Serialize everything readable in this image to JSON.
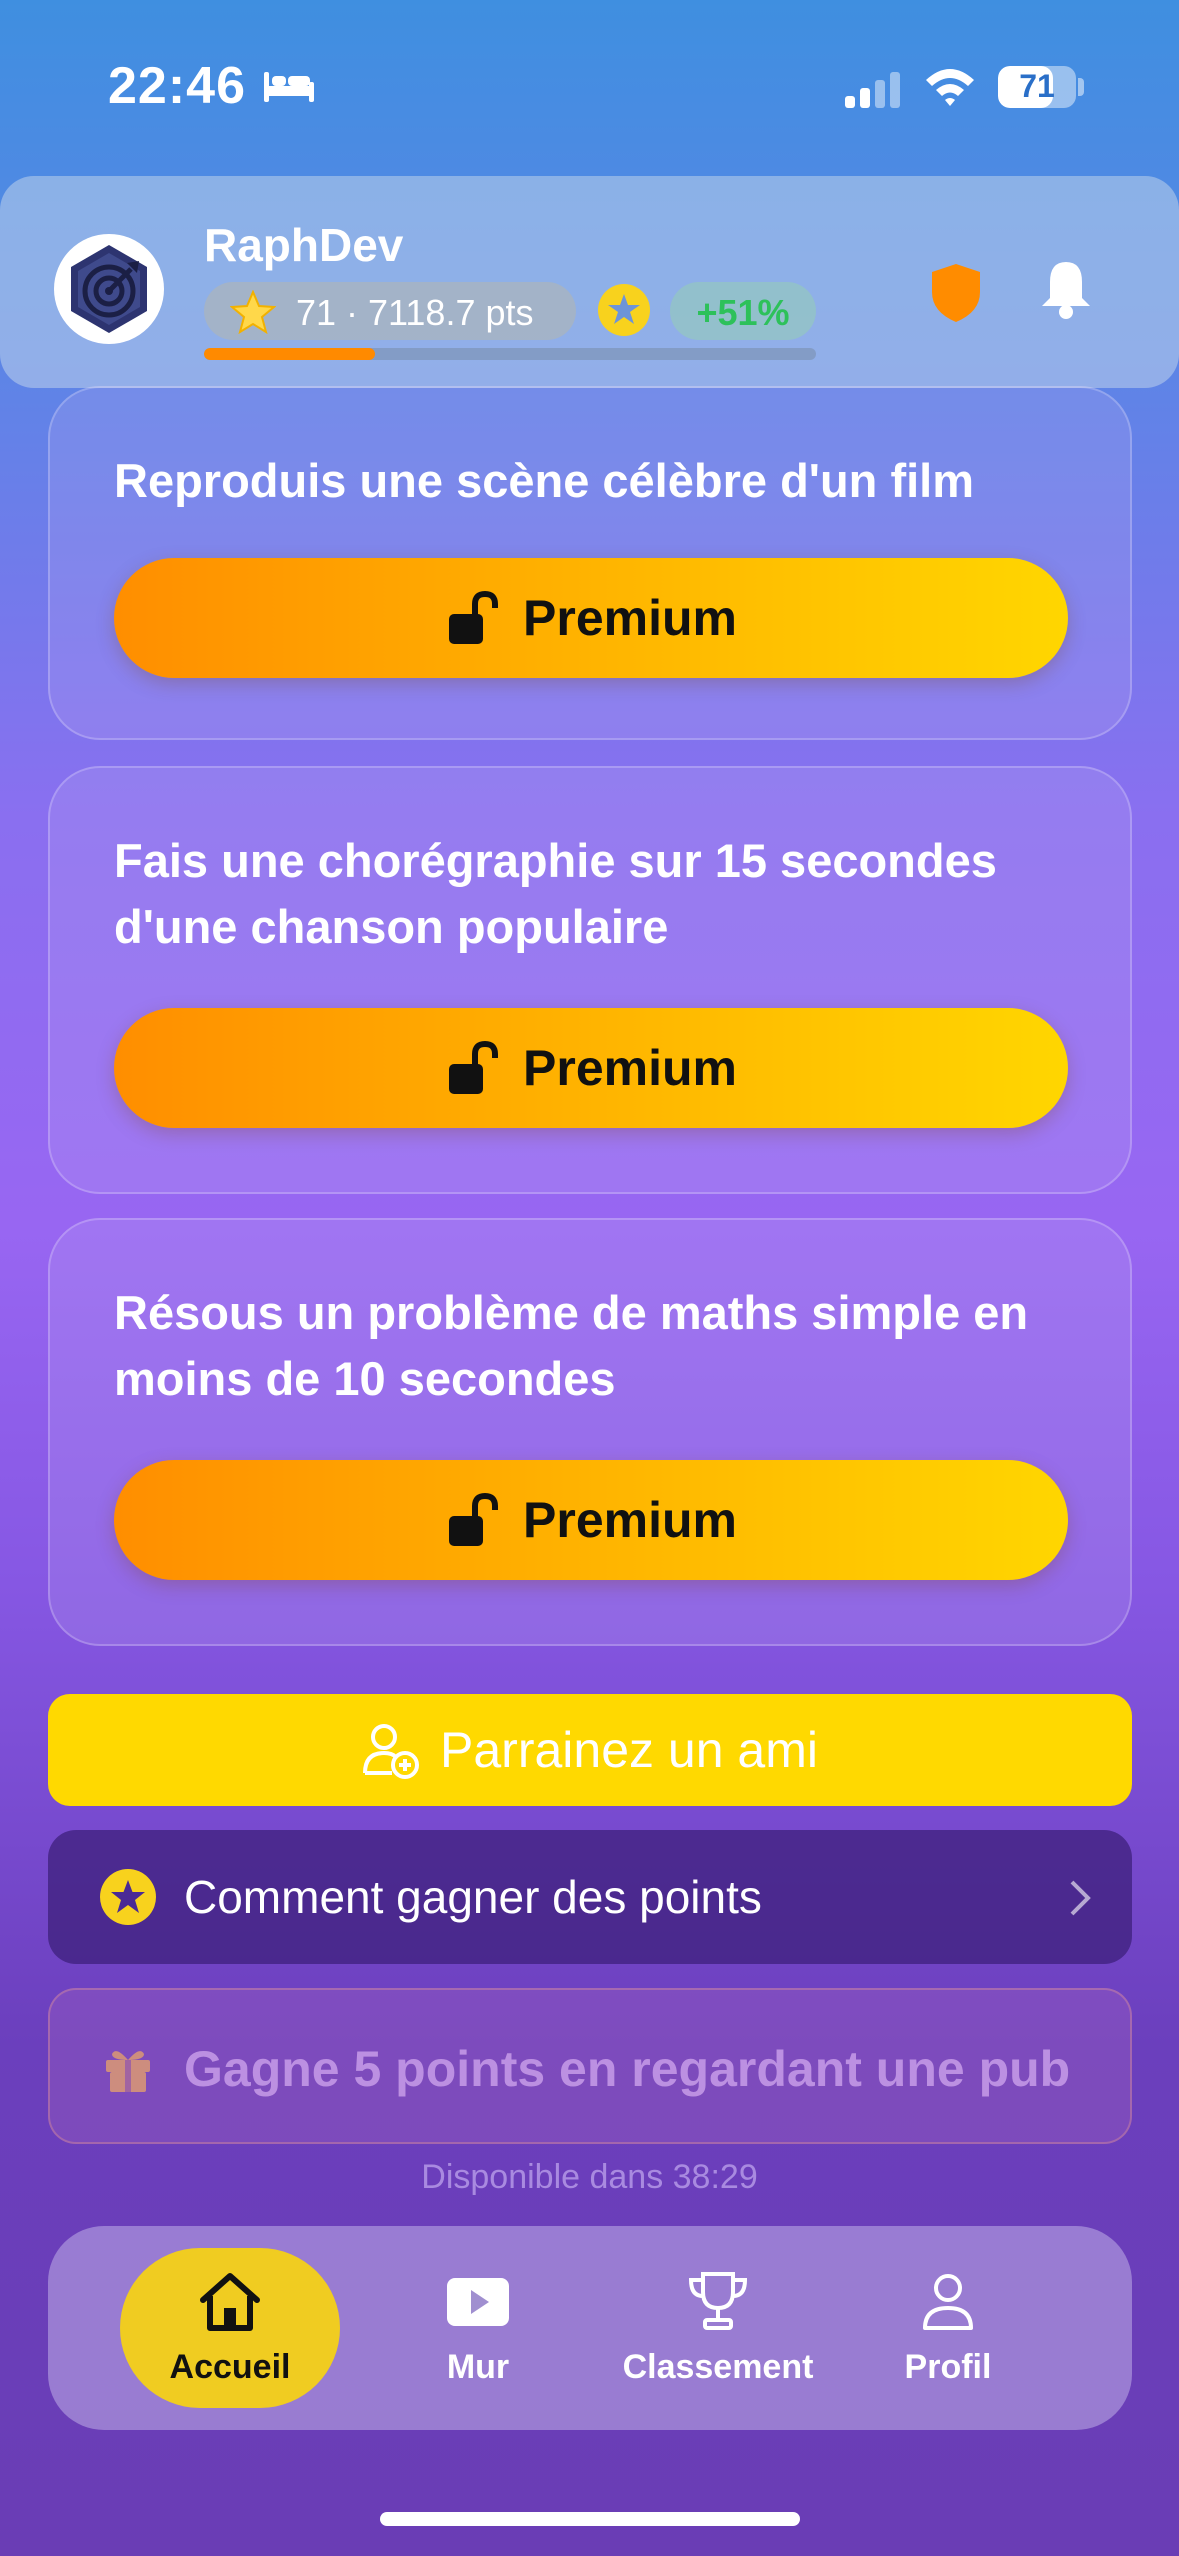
{
  "status_bar": {
    "time": "22:46",
    "battery": "71",
    "battery_level": 0.71
  },
  "header": {
    "username": "RaphDev",
    "stats": "71 · 7118.7 pts",
    "growth": "+51%",
    "progress": 0.28
  },
  "challenges": [
    {
      "title": "Reproduis une scène célèbre d'un film",
      "button_label": "Premium"
    },
    {
      "title": "Fais une chorégraphie sur 15 secondes d'une chanson populaire",
      "button_label": "Premium"
    },
    {
      "title": "Résous un problème de maths simple en moins de 10 secondes",
      "button_label": "Premium"
    }
  ],
  "referral": {
    "label": "Parrainez un ami"
  },
  "points_info": {
    "label": "Comment gagner des points"
  },
  "ad_reward": {
    "label": "Gagne 5 points en regardant une pub",
    "availability": "Disponible dans 38:29"
  },
  "tab_bar": {
    "tabs": [
      {
        "label": "Accueil",
        "icon": "home-icon",
        "active": true
      },
      {
        "label": "Mur",
        "icon": "play-icon",
        "active": false
      },
      {
        "label": "Classement",
        "icon": "trophy-icon",
        "active": false
      },
      {
        "label": "Profil",
        "icon": "person-icon",
        "active": false
      }
    ]
  },
  "colors": {
    "accent": "#ff8e00",
    "premium_end": "#ffd600",
    "referral": "#ffd900",
    "growth": "#2dc15a"
  }
}
